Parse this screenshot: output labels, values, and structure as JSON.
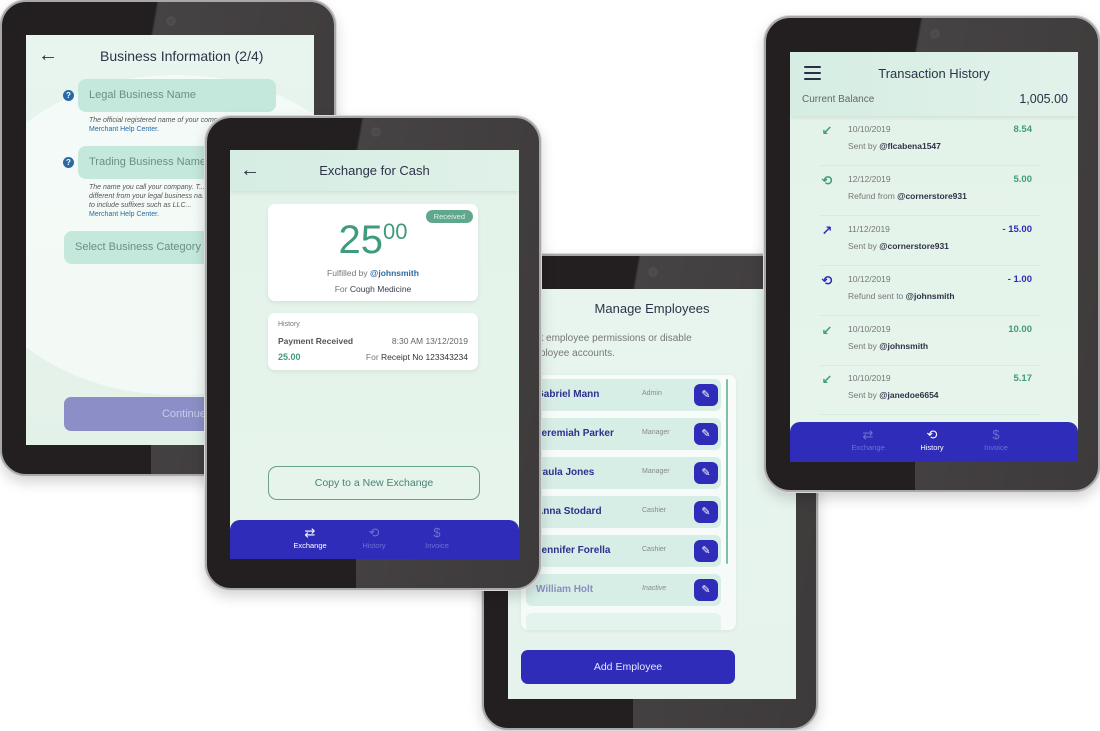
{
  "business_info": {
    "title": "Business Information (2/4)",
    "fields": [
      {
        "placeholder": "Legal Business Name",
        "hint": "The official registered name of your company...",
        "hint_link": "Merchant Help Center."
      },
      {
        "placeholder": "Trading Business Name",
        "hint": "The name you call your company. T... different from your legal business na... need to include suffixes such as LLC...",
        "hint_link": "Merchant Help Center."
      }
    ],
    "category_select": "Select Business Category",
    "continue_label": "Continue"
  },
  "exchange": {
    "title": "Exchange for Cash",
    "status_badge": "Received",
    "amount_whole": "25",
    "amount_cents": "00",
    "fulfilled_prefix": "Fulfilled by",
    "fulfilled_handle": "@johnsmith",
    "for_prefix": "For",
    "for_item": "Cough Medicine",
    "history": {
      "label": "History",
      "title": "Payment Received",
      "datetime": "8:30 AM  13/12/2019",
      "amount": "25.00",
      "receipt_prefix": "For",
      "receipt": "Receipt No 123343234"
    },
    "copy_label": "Copy to a New Exchange",
    "nav": [
      {
        "icon": "exchange-icon",
        "glyph": "⇄",
        "label": "Exchange",
        "active": true
      },
      {
        "icon": "history-icon",
        "glyph": "⟲",
        "label": "History",
        "active": false
      },
      {
        "icon": "invoice-icon",
        "glyph": "$",
        "label": "Invoice",
        "active": false
      }
    ]
  },
  "employees": {
    "title": "Manage Employees",
    "description": "Edit employee permissions or disable employee accounts.",
    "list": [
      {
        "name": "Gabriel Mann",
        "role": "Admin",
        "active": true
      },
      {
        "name": "Jeremiah Parker",
        "role": "Manager",
        "active": true
      },
      {
        "name": "Paula Jones",
        "role": "Manager",
        "active": true
      },
      {
        "name": "Anna Stodard",
        "role": "Cashier",
        "active": true
      },
      {
        "name": "Jennifer Forella",
        "role": "Cashier",
        "active": true
      },
      {
        "name": "William Holt",
        "role": "Inactive",
        "active": false
      }
    ],
    "add_label": "Add Employee"
  },
  "transactions": {
    "title": "Transaction History",
    "balance_label": "Current Balance",
    "balance_value": "1,005.00",
    "items": [
      {
        "date": "10/10/2019",
        "prefix": "Sent by",
        "handle": "@flcabena1547",
        "amount": "8.54",
        "direction": "in",
        "icon": "arrow-down-left-icon",
        "glyph": "↙"
      },
      {
        "date": "12/12/2019",
        "prefix": "Refund from",
        "handle": "@cornerstore931",
        "amount": "5.00",
        "direction": "in",
        "icon": "refund-icon",
        "glyph": "⟲"
      },
      {
        "date": "11/12/2019",
        "prefix": "Sent by",
        "handle": "@cornerstore931",
        "amount": "- 15.00",
        "direction": "out",
        "icon": "arrow-up-right-icon",
        "glyph": "↗"
      },
      {
        "date": "10/12/2019",
        "prefix": "Refund sent to",
        "handle": "@johnsmith",
        "amount": "- 1.00",
        "direction": "out",
        "icon": "refund-icon",
        "glyph": "⟲"
      },
      {
        "date": "10/10/2019",
        "prefix": "Sent by",
        "handle": "@johnsmith",
        "amount": "10.00",
        "direction": "in",
        "icon": "arrow-down-left-icon",
        "glyph": "↙"
      },
      {
        "date": "10/10/2019",
        "prefix": "Sent by",
        "handle": "@janedoe6654",
        "amount": "5.17",
        "direction": "in",
        "icon": "arrow-down-left-icon",
        "glyph": "↙"
      }
    ],
    "nav": [
      {
        "icon": "exchange-icon",
        "glyph": "⇄",
        "label": "Exchange",
        "active": false
      },
      {
        "icon": "history-icon",
        "glyph": "⟲",
        "label": "History",
        "active": true
      },
      {
        "icon": "invoice-icon",
        "glyph": "$",
        "label": "Invoice",
        "active": false
      }
    ]
  },
  "colors": {
    "brand_indigo": "#2e2cb8",
    "accent_green": "#3f9b7a",
    "screen_mint": "#e4f3ea",
    "field_mint": "#c5e8dc",
    "link_blue": "#2a6aa4"
  }
}
